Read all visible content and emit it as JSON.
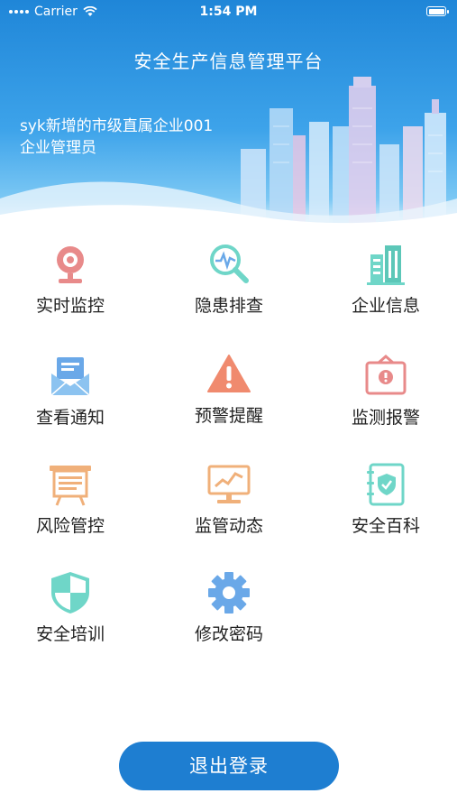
{
  "status_bar": {
    "carrier": "Carrier",
    "time": "1:54 PM"
  },
  "header": {
    "title": "安全生产信息管理平台",
    "company_name": "syk新增的市级直属企业001",
    "role": "企业管理员"
  },
  "menu": {
    "items": [
      {
        "label": "实时监控",
        "icon": "webcam-icon"
      },
      {
        "label": "隐患排查",
        "icon": "magnifier-pulse-icon"
      },
      {
        "label": "企业信息",
        "icon": "building-icon"
      },
      {
        "label": "查看通知",
        "icon": "envelope-icon"
      },
      {
        "label": "预警提醒",
        "icon": "warning-triangle-icon"
      },
      {
        "label": "监测报警",
        "icon": "alarm-board-icon"
      },
      {
        "label": "风险管控",
        "icon": "easel-board-icon"
      },
      {
        "label": "监管动态",
        "icon": "monitor-chart-icon"
      },
      {
        "label": "安全百科",
        "icon": "shield-notebook-icon"
      },
      {
        "label": "安全培训",
        "icon": "shield-icon"
      },
      {
        "label": "修改密码",
        "icon": "gear-icon"
      }
    ]
  },
  "logout": {
    "label": "退出登录"
  },
  "colors": {
    "header_blue": "#1f86d8",
    "logout_blue": "#1e7ed1",
    "icon_red": "#e88a8a",
    "icon_teal": "#6fd6c8",
    "icon_orange": "#f0b07a",
    "icon_blue": "#6aa8e8"
  }
}
